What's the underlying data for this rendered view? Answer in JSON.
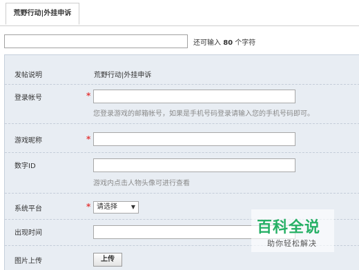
{
  "tab": {
    "label": "荒野行动|外挂申诉"
  },
  "subject": {
    "value": "",
    "remaining_prefix": "还可输入",
    "remaining_count": "80",
    "remaining_suffix": "个字符"
  },
  "form": {
    "post_desc": {
      "label": "发帖说明",
      "value": "荒野行动|外挂申诉"
    },
    "account": {
      "label": "登录帐号",
      "required": "*",
      "value": "",
      "hint": "您登录游戏的邮箱帐号，如果是手机号码登录请输入您的手机号码即可。"
    },
    "nickname": {
      "label": "游戏昵称",
      "required": "*",
      "value": ""
    },
    "digital_id": {
      "label": "数字ID",
      "value": "",
      "hint": "游戏内点击人物头像可进行查看"
    },
    "platform": {
      "label": "系统平台",
      "required": "*",
      "selected": "请选择"
    },
    "time": {
      "label": "出现时间",
      "value": ""
    },
    "image": {
      "label": "图片上传",
      "button": "上传"
    }
  },
  "watermark": {
    "title": "百科全说",
    "subtitle": "助你轻松解决"
  },
  "colors": {
    "required": "#e43d3d",
    "panel": "#e8edf3",
    "watermark": "#26b065"
  }
}
